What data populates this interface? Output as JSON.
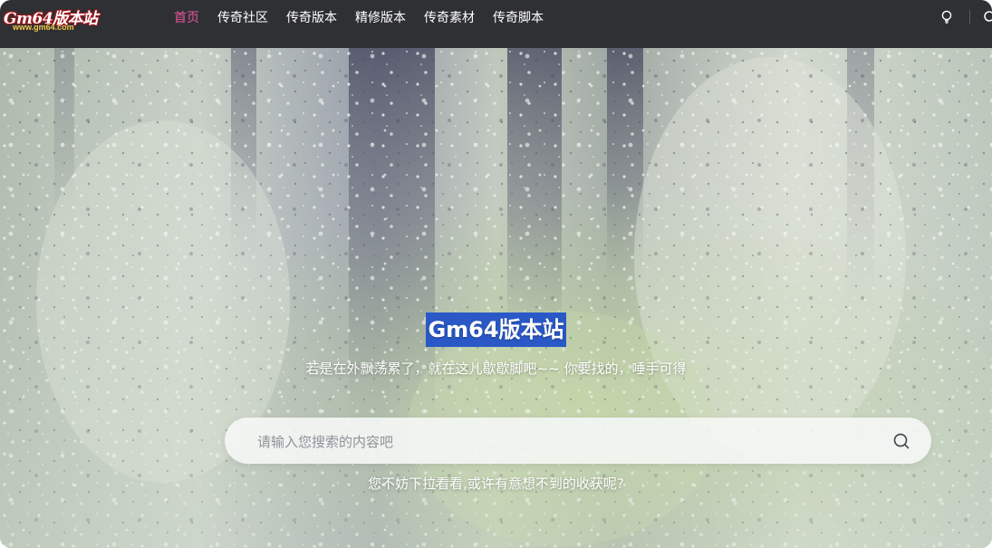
{
  "logo": {
    "main": "Gm64版本站",
    "sub": "www.gm64.com"
  },
  "nav": {
    "items": [
      {
        "label": "首页",
        "active": true
      },
      {
        "label": "传奇社区",
        "active": false
      },
      {
        "label": "传奇版本",
        "active": false
      },
      {
        "label": "精修版本",
        "active": false
      },
      {
        "label": "传奇素材",
        "active": false
      },
      {
        "label": "传奇脚本",
        "active": false
      }
    ],
    "active_color": "#e8569c",
    "bar_color": "#2f3033"
  },
  "icons": {
    "theme": "bulb-icon",
    "search": "search-icon"
  },
  "hero": {
    "title": "Gm64版本站",
    "tagline": "若是在外飘荡累了，就在这儿歇歇脚吧~~ 你要找的，唾手可得",
    "search_placeholder": "请输入您搜索的内容吧",
    "search_value": "",
    "hint": "您不妨下拉看看,或许有意想不到的收获呢?",
    "title_highlight_color": "#2a59c7"
  }
}
